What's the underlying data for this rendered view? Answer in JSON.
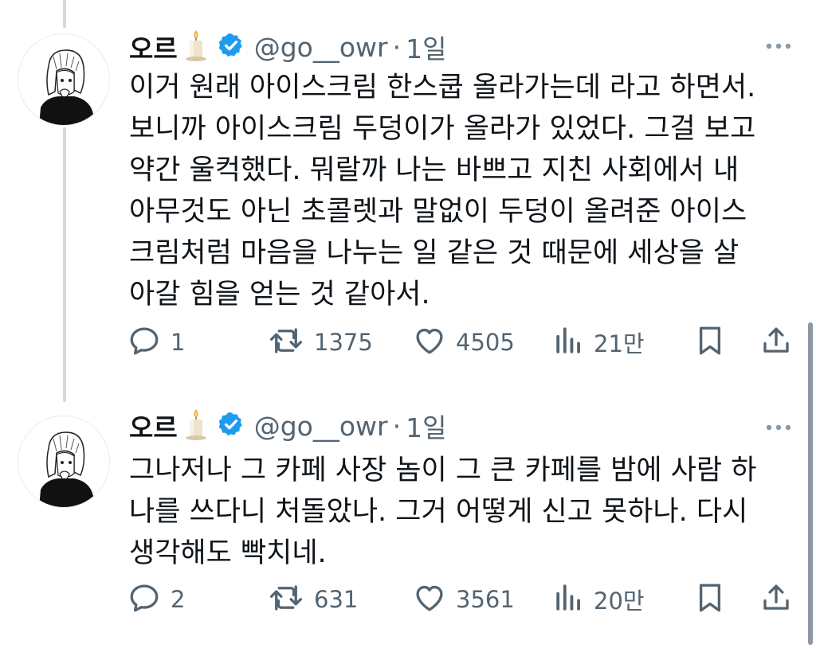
{
  "thread": {
    "tweets": [
      {
        "display_name": "오르",
        "handle": "@go__owr",
        "separator": "·",
        "time": "1일",
        "text_lines": [
          "이거 원래 아이스크림 한스쿱 올라가는데 라고 하면서.",
          "보니까 아이스크림 두덩이가 올라가 있었다. 그걸 보고",
          "약간 울컥했다. 뭐랄까 나는 바쁘고 지친 사회에서 내",
          "아무것도 아닌 초콜렛과 말없이 두덩이 올려준 아이스",
          "크림처럼 마음을 나누는 일 같은 것 때문에 세상을 살",
          "아갈 힘을 얻는 것 같아서."
        ],
        "replies": "1",
        "reposts": "1375",
        "likes": "4505",
        "views": "21만",
        "icons": {
          "avatar": "avatar-illustration",
          "badge": "candle-icon",
          "verified": "verified-badge-icon",
          "more": "more-dots-icon",
          "reply": "reply-icon",
          "repost": "repost-icon",
          "like": "heart-icon",
          "views": "views-chart-icon",
          "bookmark": "bookmark-icon",
          "share": "share-icon"
        }
      },
      {
        "display_name": "오르",
        "handle": "@go__owr",
        "separator": "·",
        "time": "1일",
        "text_lines": [
          "그나저나 그 카페 사장 놈이 그 큰 카페를 밤에 사람 하",
          "나를 쓰다니 처돌았나. 그거 어떻게 신고 못하나. 다시",
          "생각해도 빡치네."
        ],
        "replies": "2",
        "reposts": "631",
        "likes": "3561",
        "views": "20만"
      }
    ]
  },
  "colors": {
    "text": "#0f1419",
    "secondary_text": "#536471",
    "verified_blue": "#1d9bf0",
    "thread_line": "#cfd9de",
    "background": "#ffffff"
  }
}
